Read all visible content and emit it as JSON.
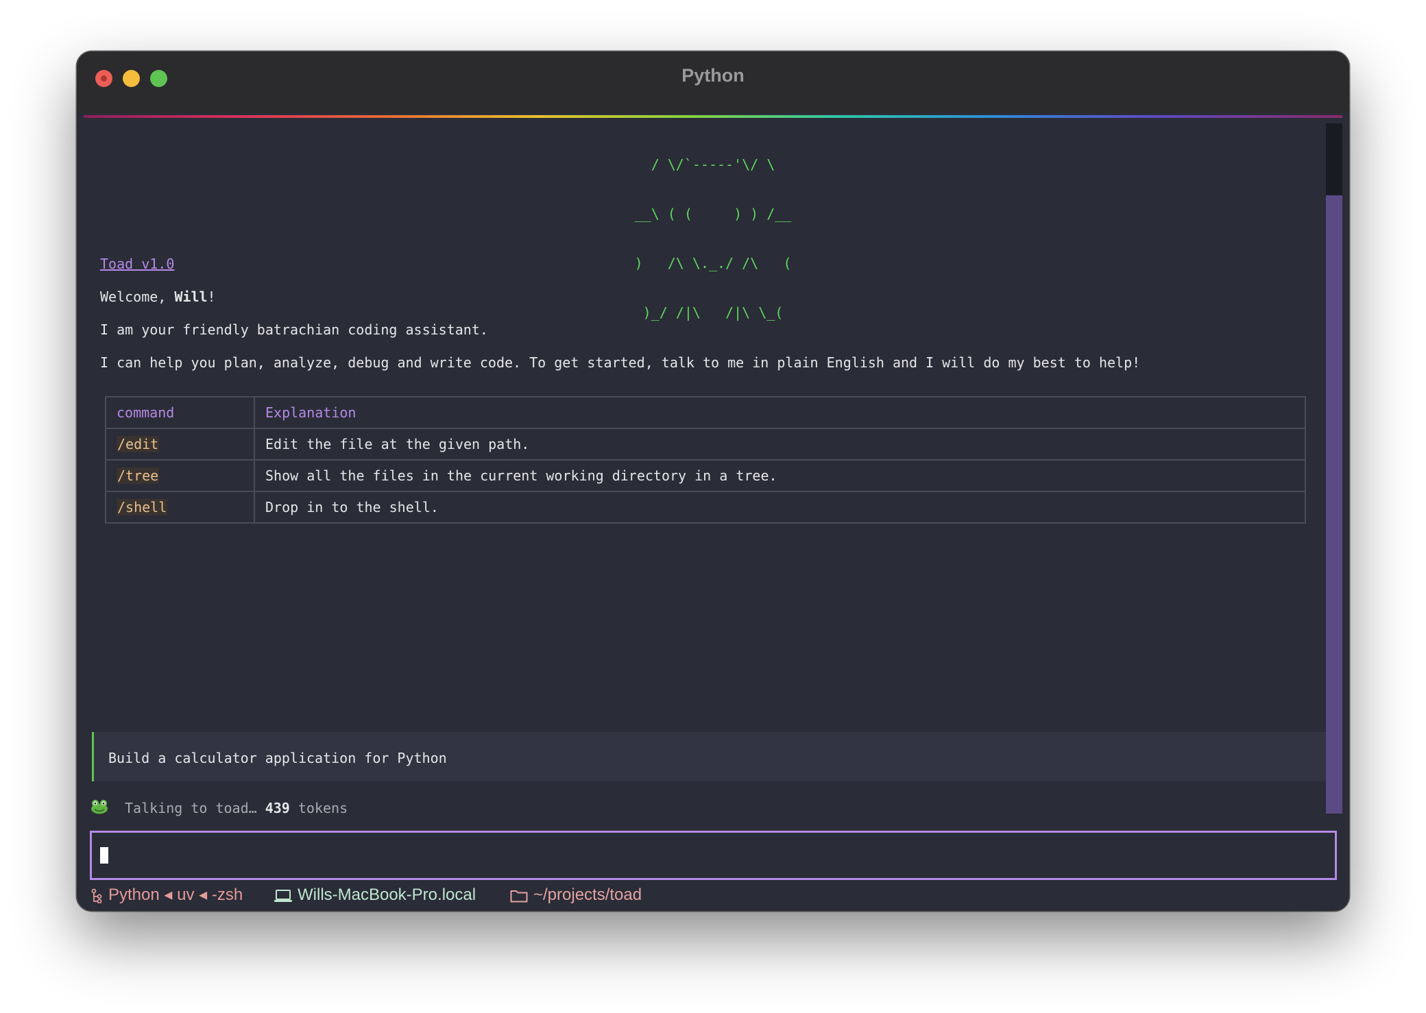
{
  "window": {
    "title": "Python"
  },
  "banner": {
    "ascii_lines": [
      "/ \\/`-----'\\/ \\",
      "__\\ ( (     ) ) /__",
      ")   /\\ \\._./ /\\   (",
      ")_/ /|\\   /|\\ \\_("
    ]
  },
  "chat": {
    "version_link": "Toad v1.0",
    "welcome_prefix": "Welcome, ",
    "user_name": "Will",
    "welcome_suffix": "!",
    "intro": "I am your friendly batrachian coding assistant.",
    "help": "I can help you plan, analyze, debug and write code. To get started, talk to me in plain English and I will do my best to help!",
    "table": {
      "headers": [
        "command",
        "Explanation"
      ],
      "rows": [
        {
          "command": "/edit",
          "explanation": "Edit the file at the given path."
        },
        {
          "command": "/tree",
          "explanation": "Show all the files in the current working directory in a tree."
        },
        {
          "command": "/shell",
          "explanation": "Drop in to the shell."
        }
      ]
    },
    "user_prompt": "Build a calculator application for Python",
    "status_prefix": "Talking to toad… ",
    "token_count": "439",
    "token_suffix": " tokens"
  },
  "input": {
    "value": ""
  },
  "statusbar": {
    "session": "Python ◂ uv ◂ -zsh",
    "host": "Wills-MacBook-Pro.local",
    "path": "~/projects/toad"
  },
  "colors": {
    "background": "#2a2c37",
    "accent": "#b48ae6",
    "ascii": "#5fd75f",
    "command_code": "#e9c08c"
  }
}
